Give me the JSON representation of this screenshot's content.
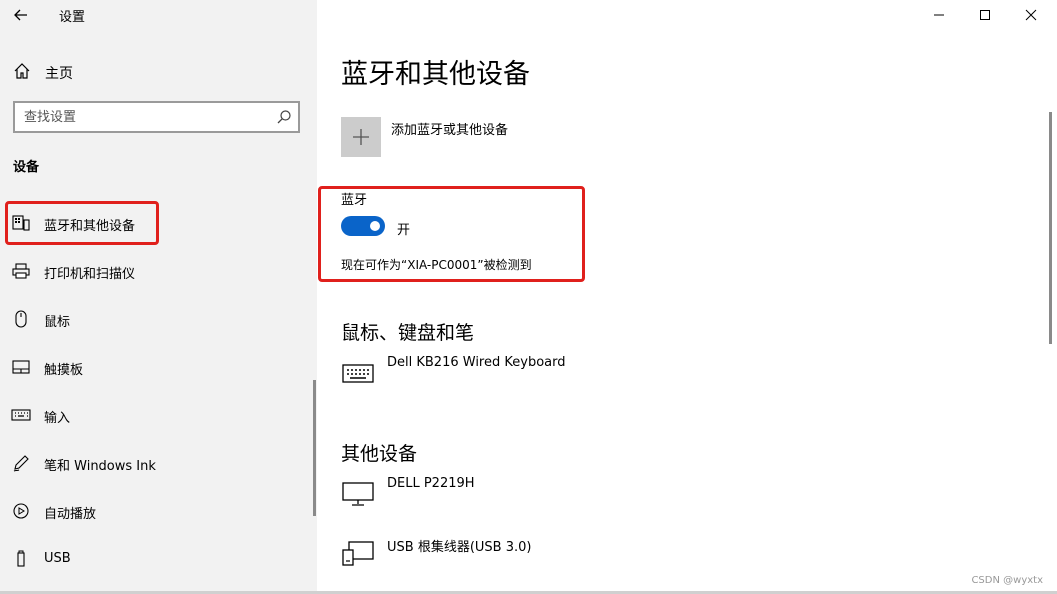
{
  "app": {
    "title": "设置",
    "back_icon": "back-arrow-icon"
  },
  "window_controls": {
    "minimize_icon": "minimize-icon",
    "maximize_icon": "maximize-icon",
    "close_icon": "close-icon"
  },
  "sidebar": {
    "home_label": "主页",
    "search": {
      "placeholder": "查找设置",
      "value": ""
    },
    "section_title": "设备",
    "items": [
      {
        "label": "蓝牙和其他设备",
        "icon": "bluetooth-devices-icon",
        "selected": true
      },
      {
        "label": "打印机和扫描仪",
        "icon": "printer-icon"
      },
      {
        "label": "鼠标",
        "icon": "mouse-icon"
      },
      {
        "label": "触摸板",
        "icon": "touchpad-icon"
      },
      {
        "label": "输入",
        "icon": "keyboard-icon"
      },
      {
        "label": "笔和 Windows Ink",
        "icon": "pen-icon"
      },
      {
        "label": "自动播放",
        "icon": "autoplay-icon"
      },
      {
        "label": "USB",
        "icon": "usb-icon"
      }
    ]
  },
  "main": {
    "title": "蓝牙和其他设备",
    "add_device_label": "添加蓝牙或其他设备",
    "bluetooth": {
      "label": "蓝牙",
      "state_label": "开",
      "enabled": true,
      "discoverable_text": "现在可作为“XIA-PC0001”被检测到"
    },
    "groups": [
      {
        "title": "鼠标、键盘和笔",
        "devices": [
          {
            "name": "Dell KB216 Wired Keyboard",
            "icon": "keyboard-icon"
          }
        ]
      },
      {
        "title": "其他设备",
        "devices": [
          {
            "name": "DELL P2219H",
            "icon": "monitor-icon"
          },
          {
            "name": "USB 根集线器(USB 3.0)",
            "icon": "usb-hub-icon"
          }
        ]
      }
    ]
  },
  "colors": {
    "accent": "#0a64c9",
    "highlight_border": "#e0201c",
    "sidebar_bg": "#f2f2f2"
  },
  "watermark": "CSDN @wyxtx"
}
